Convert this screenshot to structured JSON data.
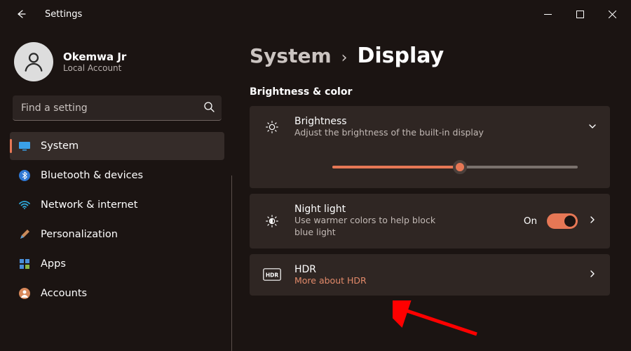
{
  "window": {
    "title": "Settings"
  },
  "user": {
    "name": "Okemwa Jr",
    "account_type": "Local Account"
  },
  "search": {
    "placeholder": "Find a setting"
  },
  "sidebar": {
    "items": [
      {
        "label": "System",
        "icon": "monitor",
        "active": true
      },
      {
        "label": "Bluetooth & devices",
        "icon": "bluetooth",
        "active": false
      },
      {
        "label": "Network & internet",
        "icon": "wifi",
        "active": false
      },
      {
        "label": "Personalization",
        "icon": "brush",
        "active": false
      },
      {
        "label": "Apps",
        "icon": "apps",
        "active": false
      },
      {
        "label": "Accounts",
        "icon": "account",
        "active": false
      }
    ]
  },
  "breadcrumb": {
    "parent": "System",
    "current": "Display"
  },
  "section": {
    "heading": "Brightness & color"
  },
  "brightness": {
    "title": "Brightness",
    "desc": "Adjust the brightness of the built-in display",
    "value_percent": 52
  },
  "nightlight": {
    "title": "Night light",
    "desc": "Use warmer colors to help block blue light",
    "state_label": "On",
    "enabled": true
  },
  "hdr": {
    "title": "HDR",
    "link": "More about HDR"
  },
  "colors": {
    "accent": "#e67755"
  }
}
